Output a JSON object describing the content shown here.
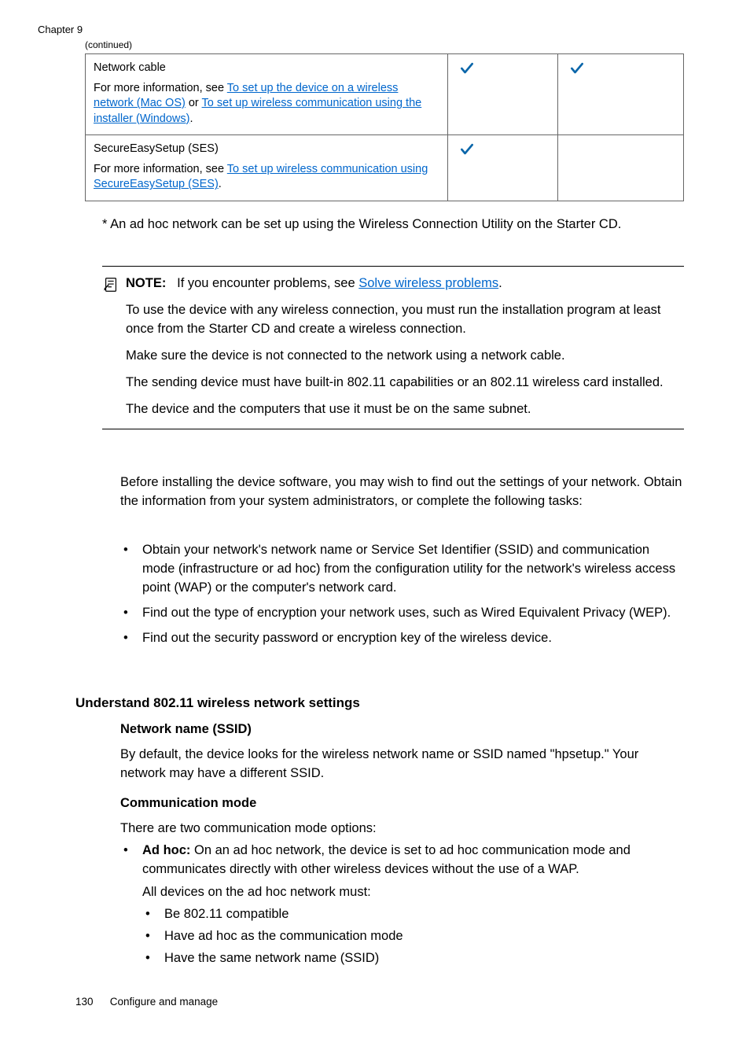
{
  "header": {
    "chapter": "Chapter 9",
    "continued": "(continued)"
  },
  "table": {
    "row1": {
      "title": "Network cable",
      "info_prefix": "For more information, see ",
      "link1": "To set up the device on a wireless network (Mac OS)",
      "mid": " or ",
      "link2": "To set up wireless communication using the installer (Windows)",
      "suffix": "."
    },
    "row2": {
      "title": "SecureEasySetup (SES)",
      "info_prefix": "For more information, see ",
      "link1": "To set up wireless communication using SecureEasySetup (SES)",
      "suffix": "."
    }
  },
  "adhoc_note": "* An ad hoc network can be set up using the Wireless Connection Utility on the Starter CD.",
  "note": {
    "label": "NOTE:",
    "line1_prefix": "If you encounter problems, see ",
    "line1_link": "Solve wireless problems",
    "line1_suffix": ".",
    "p1": "To use the device with any wireless connection, you must run the installation program at least once from the Starter CD and create a wireless connection.",
    "p2": "Make sure the device is not connected to the network using a network cable.",
    "p3": "The sending device must have built-in 802.11 capabilities or an 802.11 wireless card installed.",
    "p4": "The device and the computers that use it must be on the same subnet."
  },
  "before": "Before installing the device software, you may wish to find out the settings of your network. Obtain the information from your system administrators, or complete the following tasks:",
  "bullets": {
    "b1": "Obtain your network's network name or Service Set Identifier (SSID) and communication mode (infrastructure or ad hoc) from the configuration utility for the network's wireless access point (WAP) or the computer's network card.",
    "b2": "Find out the type of encryption your network uses, such as Wired Equivalent Privacy (WEP).",
    "b3": "Find out the security password or encryption key of the wireless device."
  },
  "section": {
    "heading": "Understand 802.11 wireless network settings",
    "ssid_heading": "Network name (SSID)",
    "ssid_p": "By default, the device looks for the wireless network name or SSID named \"hpsetup.\" Your network may have a different SSID.",
    "comm_heading": "Communication mode",
    "comm_intro": "There are two communication mode options:",
    "adhoc_label": "Ad hoc:",
    "adhoc_text": " On an ad hoc network, the device is set to ad hoc communication mode and communicates directly with other wireless devices without the use of a WAP.",
    "adhoc_sub": "All devices on the ad hoc network must:",
    "inner1": "Be 802.11 compatible",
    "inner2": "Have ad hoc as the communication mode",
    "inner3": "Have the same network name (SSID)"
  },
  "footer": {
    "page": "130",
    "title": "Configure and manage"
  }
}
